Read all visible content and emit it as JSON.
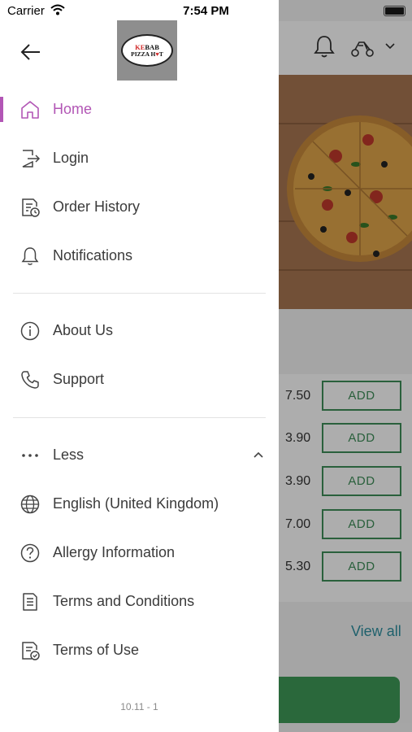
{
  "status_bar": {
    "carrier": "Carrier",
    "time": "7:54 PM"
  },
  "drawer": {
    "logo": {
      "line1_red": "KE",
      "line1": "BAB",
      "line2": "PIZZA H",
      "line2_red": "♥",
      "line2_end": "T"
    },
    "nav_items": [
      {
        "label": "Home",
        "icon": "home-icon",
        "active": true
      },
      {
        "label": "Login",
        "icon": "login-icon"
      },
      {
        "label": "Order History",
        "icon": "order-history-icon"
      },
      {
        "label": "Notifications",
        "icon": "bell-icon"
      }
    ],
    "info_items": [
      {
        "label": "About Us",
        "icon": "info-icon"
      },
      {
        "label": "Support",
        "icon": "phone-icon"
      }
    ],
    "less_label": "Less",
    "more_items": [
      {
        "label": "English (United Kingdom)",
        "icon": "globe-icon"
      },
      {
        "label": "Allergy Information",
        "icon": "question-icon"
      },
      {
        "label": "Terms and Conditions",
        "icon": "document-icon"
      },
      {
        "label": "Terms of Use",
        "icon": "document-check-icon"
      }
    ],
    "version": "10.11 - 1"
  },
  "background_app": {
    "prices": [
      "7.50",
      "3.90",
      "3.90",
      "7.00",
      "5.30"
    ],
    "add_label": "ADD",
    "view_all": "View all"
  },
  "colors": {
    "accent": "#b256b5",
    "green": "#3e8e59",
    "link": "#2e8fa0"
  }
}
